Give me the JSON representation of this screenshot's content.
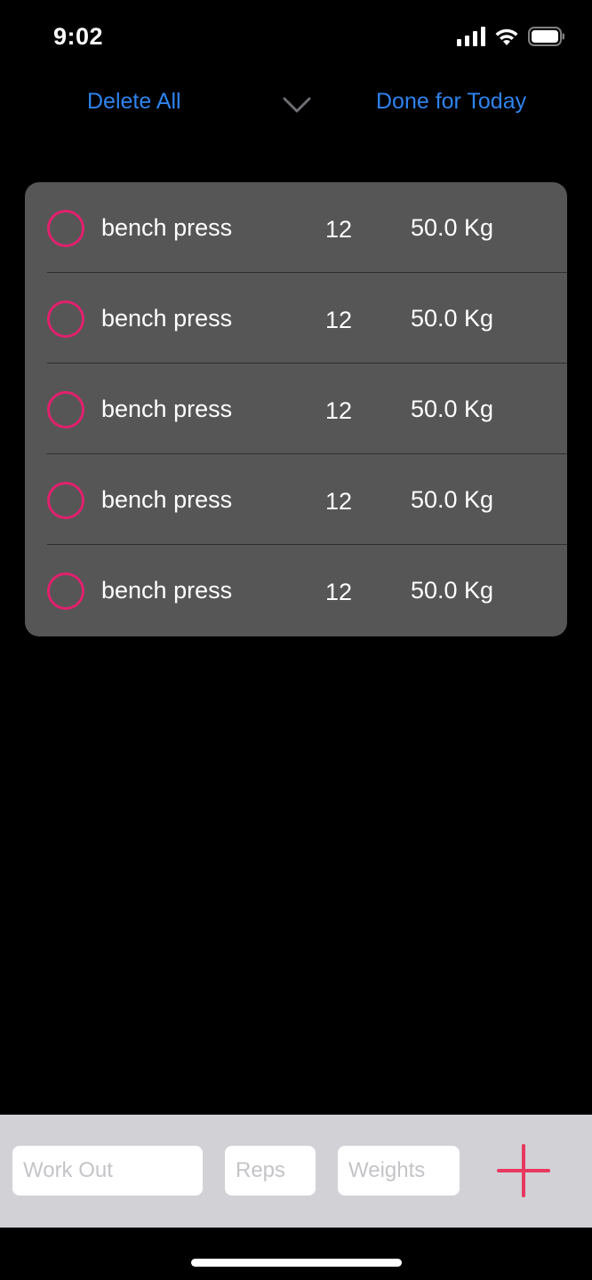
{
  "status_bar": {
    "time": "9:02",
    "icons": [
      "cellular-signal-icon",
      "wifi-icon",
      "battery-icon"
    ]
  },
  "nav": {
    "delete_all_label": "Delete All",
    "done_label": "Done for Today",
    "chevron_icon": "chevron-down-icon"
  },
  "workouts": [
    {
      "name": "bench press",
      "reps": "12",
      "weight": "50.0 Kg"
    },
    {
      "name": "bench press",
      "reps": "12",
      "weight": "50.0 Kg"
    },
    {
      "name": "bench press",
      "reps": "12",
      "weight": "50.0 Kg"
    },
    {
      "name": "bench press",
      "reps": "12",
      "weight": "50.0 Kg"
    },
    {
      "name": "bench press",
      "reps": "12",
      "weight": "50.0 Kg"
    }
  ],
  "input_bar": {
    "workout_placeholder": "Work Out",
    "reps_placeholder": "Reps",
    "weights_placeholder": "Weights",
    "add_icon": "plus-icon"
  },
  "colors": {
    "accent_blue": "#2f83ee",
    "accent_pink": "#e0216c",
    "card_bg": "#565656",
    "input_bar_bg": "#d1d1d6"
  }
}
